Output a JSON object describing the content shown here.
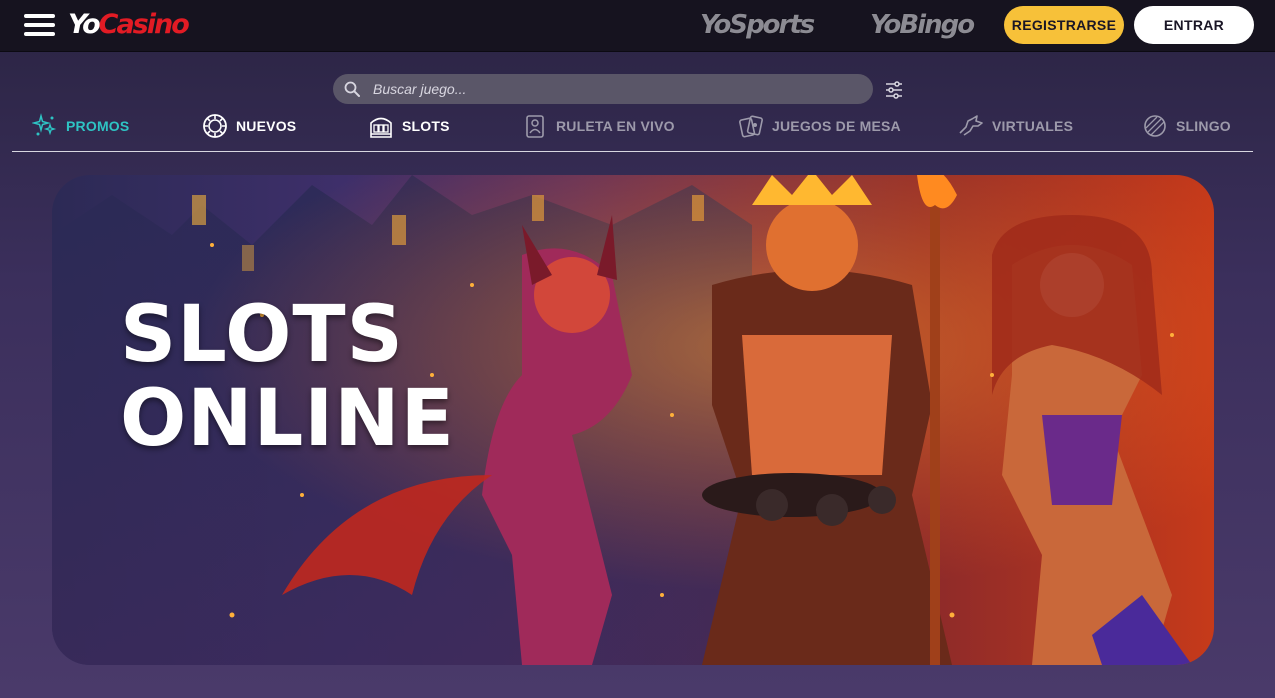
{
  "header": {
    "logo_yo": "Yo",
    "logo_casino": "Casino",
    "brand_sports": "YoSports",
    "brand_bingo": "YoBingo",
    "register_label": "REGISTRARSE",
    "login_label": "ENTRAR"
  },
  "search": {
    "placeholder": "Buscar juego...",
    "value": ""
  },
  "categories": [
    {
      "label": "PROMOS",
      "icon": "sparkles-icon",
      "state": "active"
    },
    {
      "label": "NUEVOS",
      "icon": "chip-icon",
      "state": "normal"
    },
    {
      "label": "SLOTS",
      "icon": "slot-machine-icon",
      "state": "normal"
    },
    {
      "label": "RULETA EN VIVO",
      "icon": "live-dealer-icon",
      "state": "dim"
    },
    {
      "label": "JUEGOS DE MESA",
      "icon": "cards-icon",
      "state": "dim"
    },
    {
      "label": "VIRTUALES",
      "icon": "horse-icon",
      "state": "dim"
    },
    {
      "label": "SLINGO",
      "icon": "ball-icon",
      "state": "dim"
    }
  ],
  "hero": {
    "title_line1": "SLOTS",
    "title_line2": "ONLINE"
  },
  "colors": {
    "accent_teal": "#2ec4c4",
    "register_yellow": "#f7c139",
    "brand_red": "#e21b24",
    "topbar_bg": "#16131f"
  }
}
